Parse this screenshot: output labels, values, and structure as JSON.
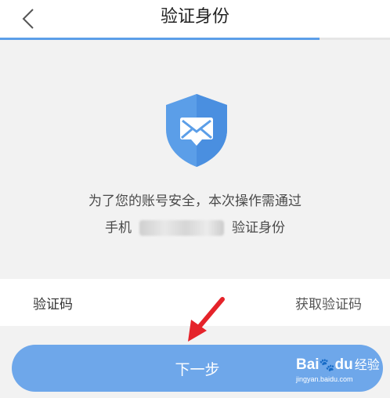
{
  "header": {
    "title": "验证身份",
    "back_icon": "chevron-left-icon"
  },
  "progress": {
    "fraction": 0.82,
    "color": "#5b9ee8"
  },
  "illustration": {
    "icon": "shield-envelope-icon",
    "color": "#5b9ee8"
  },
  "notice": {
    "line1": "为了您的账号安全，本次操作需通过",
    "line2_prefix": "手机",
    "line2_suffix": "验证身份"
  },
  "verification": {
    "label": "验证码",
    "value": "",
    "get_code_label": "获取验证码"
  },
  "next_button": {
    "label": "下一步",
    "color": "#6ea7ea"
  },
  "annotation": {
    "icon": "red-arrow-icon",
    "color": "#e5232a"
  },
  "watermark": {
    "logo_text": "Bai",
    "logo_text2": "du",
    "cn_text": "经验",
    "url_text": "jingyan.baidu.com"
  }
}
